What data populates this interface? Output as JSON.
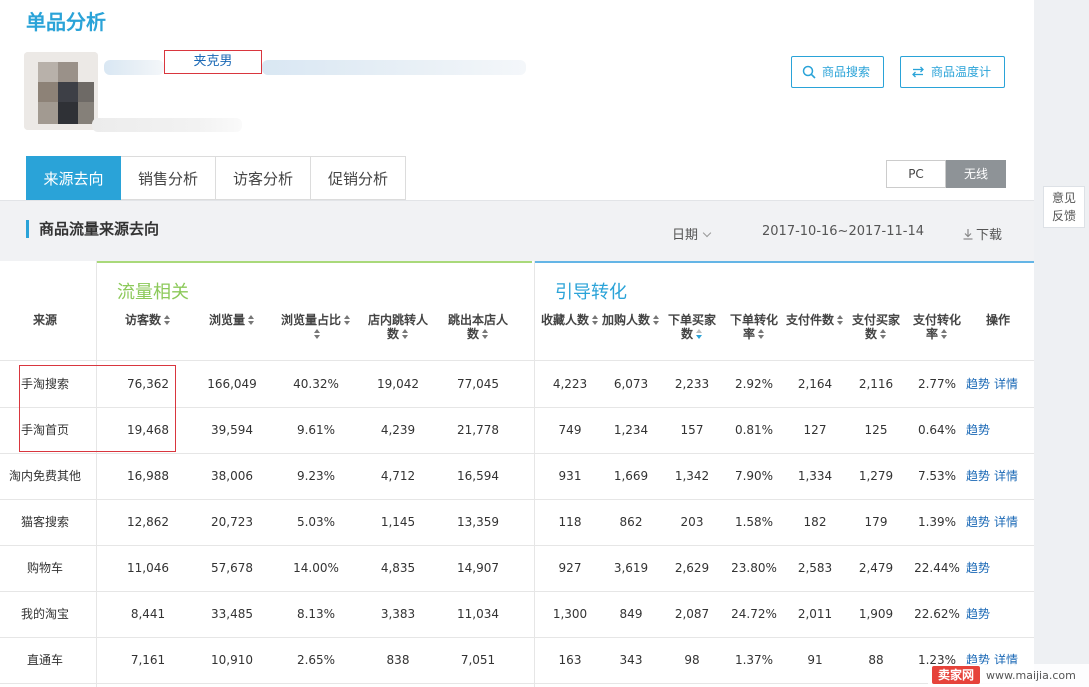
{
  "page": {
    "title": "单品分析"
  },
  "product": {
    "name": "夹克男"
  },
  "buttons": {
    "search": "商品搜索",
    "thermo": "商品温度计"
  },
  "tabs": [
    "来源去向",
    "销售分析",
    "访客分析",
    "促销分析"
  ],
  "device": {
    "pc": "PC",
    "wireless": "无线",
    "selected": "无线"
  },
  "feedback": {
    "line1": "意见",
    "line2": "反馈"
  },
  "section": {
    "title": "商品流量来源去向",
    "date_label": "日期",
    "date_range": "2017-10-16~2017-11-14",
    "download": "下载"
  },
  "groups": {
    "traffic": "流量相关",
    "conversion": "引导转化"
  },
  "columns": {
    "source": "来源",
    "visitors": "访客数",
    "pageviews": "浏览量",
    "pv_share": [
      "浏览量占比"
    ],
    "in_store": [
      "店内跳转人",
      "数"
    ],
    "out_store": [
      "跳出本店人",
      "数"
    ],
    "favorites": "收藏人数",
    "add_cart": "加购人数",
    "order_buyers": [
      "下单买家",
      "数"
    ],
    "order_rate": [
      "下单转化",
      "率"
    ],
    "pay_items": "支付件数",
    "pay_buyers": [
      "支付买家",
      "数"
    ],
    "pay_rate": [
      "支付转化",
      "率"
    ],
    "action": "操作"
  },
  "rows": [
    {
      "source": "手淘搜索",
      "visitors": "76,362",
      "pageviews": "166,049",
      "pv_share": "40.32%",
      "in_store": "19,042",
      "out_store": "77,045",
      "favorites": "4,223",
      "add_cart": "6,073",
      "order_buyers": "2,233",
      "order_rate": "2.92%",
      "pay_items": "2,164",
      "pay_buyers": "2,116",
      "pay_rate": "2.77%",
      "trend": "趋势",
      "detail": "详情"
    },
    {
      "source": "手淘首页",
      "visitors": "19,468",
      "pageviews": "39,594",
      "pv_share": "9.61%",
      "in_store": "4,239",
      "out_store": "21,778",
      "favorites": "749",
      "add_cart": "1,234",
      "order_buyers": "157",
      "order_rate": "0.81%",
      "pay_items": "127",
      "pay_buyers": "125",
      "pay_rate": "0.64%",
      "trend": "趋势",
      "detail": ""
    },
    {
      "source": "淘内免费其他",
      "visitors": "16,988",
      "pageviews": "38,006",
      "pv_share": "9.23%",
      "in_store": "4,712",
      "out_store": "16,594",
      "favorites": "931",
      "add_cart": "1,669",
      "order_buyers": "1,342",
      "order_rate": "7.90%",
      "pay_items": "1,334",
      "pay_buyers": "1,279",
      "pay_rate": "7.53%",
      "trend": "趋势",
      "detail": "详情"
    },
    {
      "source": "猫客搜索",
      "visitors": "12,862",
      "pageviews": "20,723",
      "pv_share": "5.03%",
      "in_store": "1,145",
      "out_store": "13,359",
      "favorites": "118",
      "add_cart": "862",
      "order_buyers": "203",
      "order_rate": "1.58%",
      "pay_items": "182",
      "pay_buyers": "179",
      "pay_rate": "1.39%",
      "trend": "趋势",
      "detail": "详情"
    },
    {
      "source": "购物车",
      "visitors": "11,046",
      "pageviews": "57,678",
      "pv_share": "14.00%",
      "in_store": "4,835",
      "out_store": "14,907",
      "favorites": "927",
      "add_cart": "3,619",
      "order_buyers": "2,629",
      "order_rate": "23.80%",
      "pay_items": "2,583",
      "pay_buyers": "2,479",
      "pay_rate": "22.44%",
      "trend": "趋势",
      "detail": ""
    },
    {
      "source": "我的淘宝",
      "visitors": "8,441",
      "pageviews": "33,485",
      "pv_share": "8.13%",
      "in_store": "3,383",
      "out_store": "11,034",
      "favorites": "1,300",
      "add_cart": "849",
      "order_buyers": "2,087",
      "order_rate": "24.72%",
      "pay_items": "2,011",
      "pay_buyers": "1,909",
      "pay_rate": "22.62%",
      "trend": "趋势",
      "detail": ""
    },
    {
      "source": "直通车",
      "visitors": "7,161",
      "pageviews": "10,910",
      "pv_share": "2.65%",
      "in_store": "838",
      "out_store": "7,051",
      "favorites": "163",
      "add_cart": "343",
      "order_buyers": "98",
      "order_rate": "1.37%",
      "pay_items": "91",
      "pay_buyers": "88",
      "pay_rate": "1.23%",
      "trend": "趋势",
      "detail": "详情"
    }
  ],
  "watermark": {
    "logo": "卖家网",
    "url": "www.maijia.com"
  }
}
